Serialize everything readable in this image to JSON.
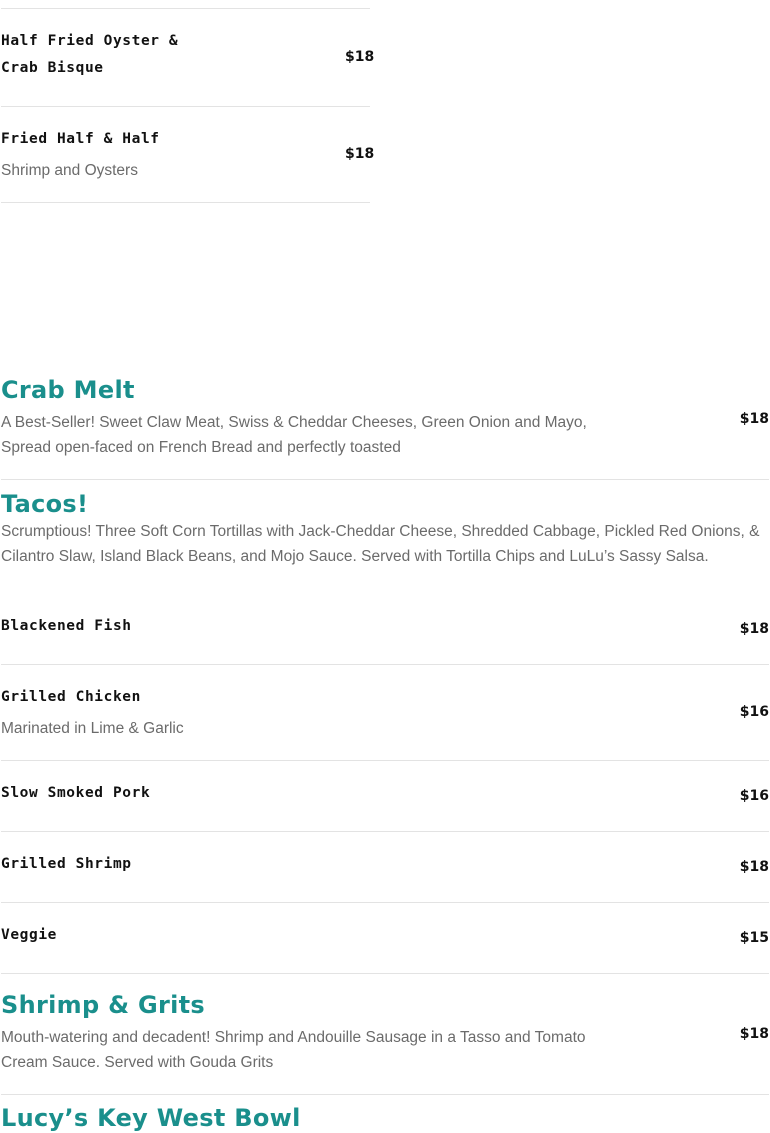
{
  "top_items": [
    {
      "name": "Half Fried Oyster & Crab Bisque",
      "price": "$18"
    },
    {
      "name": "Fried Half & Half",
      "description": "Shrimp and Oysters",
      "price": "$18"
    }
  ],
  "crab_melt": {
    "title": "Crab Melt",
    "description": "A Best-Seller! Sweet Claw Meat, Swiss & Cheddar Cheeses, Green Onion and Mayo, Spread open-faced on French Bread and perfectly toasted",
    "price": "$18"
  },
  "tacos": {
    "title": "Tacos!",
    "description": "Scrumptious! Three Soft Corn Tortillas with Jack-Cheddar Cheese, Shredded Cabbage, Pickled Red Onions, & Cilantro Slaw, Island Black Beans, and Mojo Sauce. Served with Tortilla Chips and LuLu’s Sassy Salsa.",
    "items": [
      {
        "name": "Blackened Fish",
        "price": "$18"
      },
      {
        "name": "Grilled Chicken",
        "description": "Marinated in Lime & Garlic",
        "price": "$16"
      },
      {
        "name": "Slow Smoked Pork",
        "price": "$16"
      },
      {
        "name": "Grilled Shrimp",
        "price": "$18"
      },
      {
        "name": "Veggie",
        "price": "$15"
      }
    ]
  },
  "shrimp_grits": {
    "title": "Shrimp & Grits",
    "description": "Mouth-watering and decadent! Shrimp and Andouille Sausage in a Tasso and Tomato Cream Sauce. Served with Gouda Grits",
    "price": "$18"
  },
  "next_section": {
    "title": "Lucy’s Key West Bowl"
  },
  "colors": {
    "accent": "#1a8f8c",
    "text": "#111111",
    "muted": "#6b6b6b",
    "rule": "#e3e3e3"
  }
}
